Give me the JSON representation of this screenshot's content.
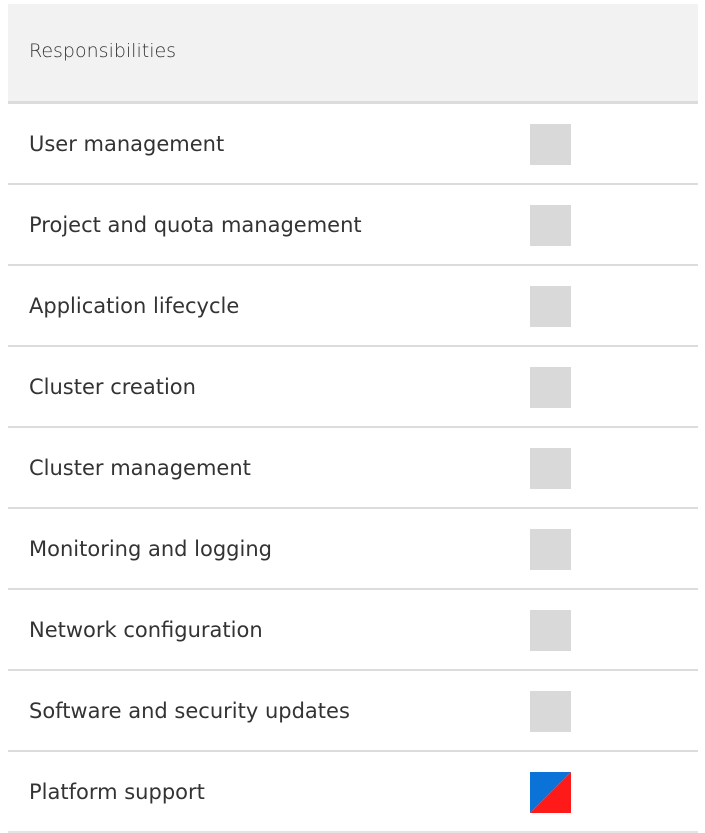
{
  "table": {
    "header": "Responsibilities",
    "rows": [
      {
        "label": "User management",
        "indicator": "empty",
        "color": "#d9d9d9"
      },
      {
        "label": "Project and quota management",
        "indicator": "empty",
        "color": "#d9d9d9"
      },
      {
        "label": "Application lifecycle",
        "indicator": "empty",
        "color": "#d9d9d9"
      },
      {
        "label": "Cluster creation",
        "indicator": "empty",
        "color": "#d9d9d9"
      },
      {
        "label": "Cluster management",
        "indicator": "empty",
        "color": "#d9d9d9"
      },
      {
        "label": "Monitoring and logging",
        "indicator": "empty",
        "color": "#d9d9d9"
      },
      {
        "label": "Network configuration",
        "indicator": "empty",
        "color": "#d9d9d9"
      },
      {
        "label": "Software and security updates",
        "indicator": "empty",
        "color": "#d9d9d9"
      },
      {
        "label": "Platform support",
        "indicator": "shared",
        "colors": [
          "#0b73d8",
          "#ff1a1a"
        ]
      }
    ]
  }
}
